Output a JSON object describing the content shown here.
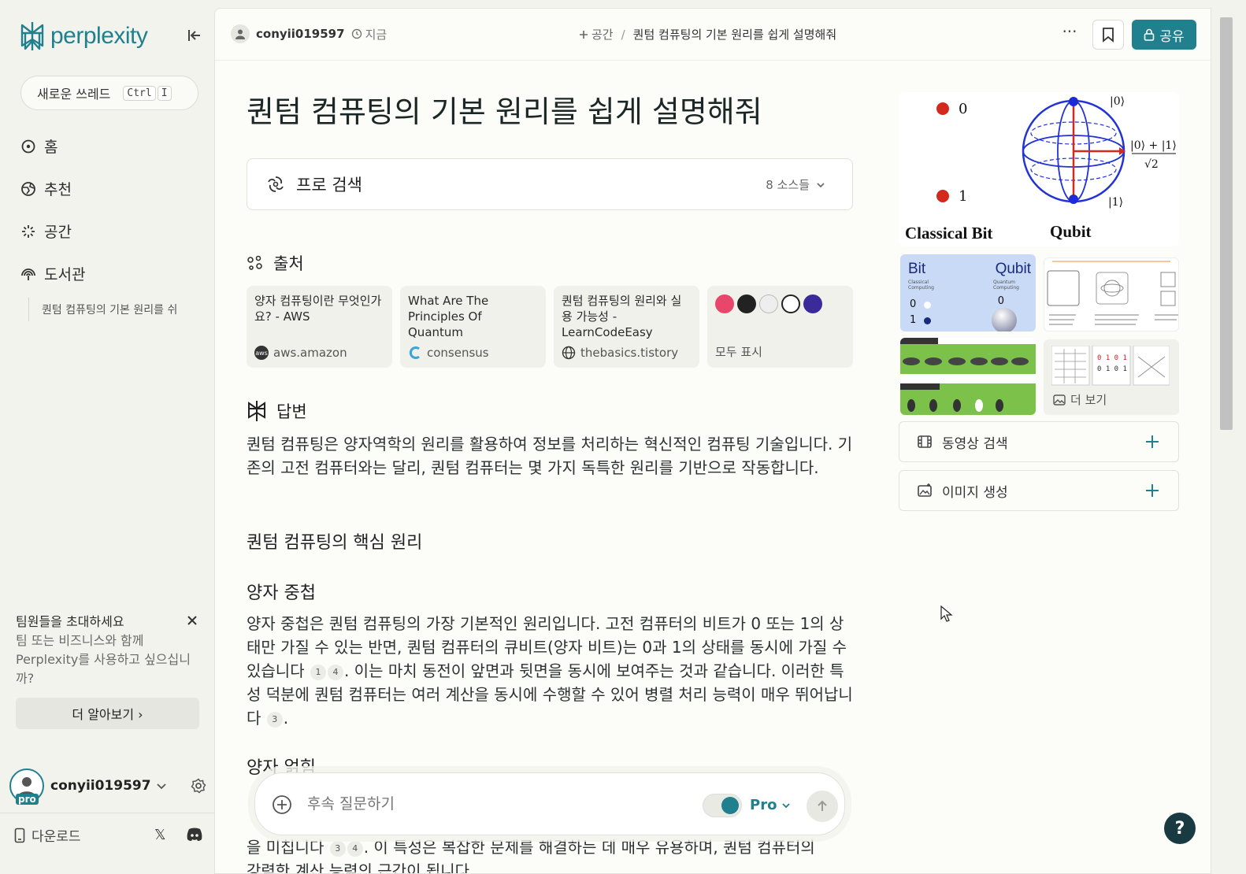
{
  "sidebar": {
    "logo_text": "perplexity",
    "new_thread": {
      "label": "새로운 쓰레드",
      "kbd1": "Ctrl",
      "kbd2": "I"
    },
    "nav": [
      {
        "label": "홈",
        "icon": "home-search-icon"
      },
      {
        "label": "추천",
        "icon": "globe-icon"
      },
      {
        "label": "공간",
        "icon": "spaces-icon"
      },
      {
        "label": "도서관",
        "icon": "library-icon"
      }
    ],
    "recent_thread": "퀀텀 컴퓨팅의 기본 원리를 쉬",
    "invite": {
      "title": "팀원들을 초대하세요",
      "body": "팀 또는 비즈니스와 함께 Perplexity를 사용하고 싶으십니까?",
      "button": "더 알아보기 ›"
    },
    "user": {
      "name": "conyii019597",
      "badge": "pro"
    },
    "download": "다운로드"
  },
  "topbar": {
    "username": "conyii019597",
    "time": "지금",
    "space": "공간",
    "separator": "/",
    "thread_title": "퀀텀 컴퓨팅의 기본 원리를 쉽게 설명해줘",
    "more": "···",
    "share": "공유"
  },
  "question": "퀀텀 컴퓨팅의 기본 원리를 쉽게 설명해줘",
  "pro_search": {
    "label": "프로 검색",
    "sources_count": "8 소스들"
  },
  "sources_heading": "출처",
  "sources": [
    {
      "title": "양자 컴퓨팅이란 무엇인가요? - AWS",
      "site": "aws.amazon"
    },
    {
      "title": "What Are The Principles Of Quantum Computing? -...",
      "site": "consensus"
    },
    {
      "title": "퀀텀 컴퓨팅의 원리와 실용 가능성 - LearnCodeEasy",
      "site": "thebasics.tistory"
    }
  ],
  "show_all": "모두 표시",
  "answer_heading": "답변",
  "answer": {
    "intro": "퀀텀 컴퓨팅은 양자역학의 원리를 활용하여 정보를 처리하는 혁신적인 컴퓨팅 기술입니다. 기존의 고전 컴퓨터와는 달리, 퀀텀 컴퓨터는 몇 가지 독특한 원리를 기반으로 작동합니다.",
    "h_core": "퀀텀 컴퓨팅의 핵심 원리",
    "h_superposition": "양자 중첩",
    "sup_1": "양자 중첩은 퀀텀 컴퓨팅의 가장 기본적인 원리입니다. 고전 컴퓨터의 비트가 0 또는 1의 상태만 가질 수 있는 반면, 퀀텀 컴퓨터의 큐비트(양자 비트)는 0과 1의 상태를 동시에 가질 수 있습니다",
    "sup_cite_a": "1",
    "sup_cite_b": "4",
    "sup_2": ". 이는 마치 동전이 앞면과 뒷면을 동시에 보여주는 것과 같습니다. 이러한 특성 덕분에 퀀텀 컴퓨터는 여러 계산을 동시에 수행할 수 있어 병렬 처리 능력이 매우 뛰어납니다",
    "sup_cite_c": "3",
    "sup_3": ".",
    "h_entanglement": "양자 얽힘",
    "tail_1": "을 미칩니다",
    "tail_cite_a": "3",
    "tail_cite_b": "4",
    "tail_2": ". 이 특성은 복잡한 문제를 해결하는 데 매우 유용하며, 퀀텀 컴퓨터의",
    "tail_3": "강력한 계산 능력의 근간이 됩니다"
  },
  "followup": {
    "placeholder": "후속 질문하기",
    "model": "Pro"
  },
  "images": {
    "hero": {
      "label_left": "Classical Bit",
      "label_right": "Qubit",
      "state0": "0",
      "state1": "1",
      "ket0": "|0⟩",
      "ket1": "|1⟩",
      "plus": "|0⟩ + |1⟩",
      "sqrt": "√2"
    },
    "thumb1": {
      "bit": "Bit",
      "qubit": "Qubit",
      "sub_bit": "Classical Computing",
      "sub_qubit": "Quantum Computing",
      "zero": "0",
      "one": "1"
    },
    "more": "더 보기"
  },
  "actions": [
    {
      "label": "동영상 검색",
      "icon": "video-icon"
    },
    {
      "label": "이미지 생성",
      "icon": "image-generate-icon"
    }
  ],
  "help": "?",
  "colors": {
    "accent": "#20808d",
    "background": "#f3f3ee",
    "panel": "#fcfcf9"
  }
}
